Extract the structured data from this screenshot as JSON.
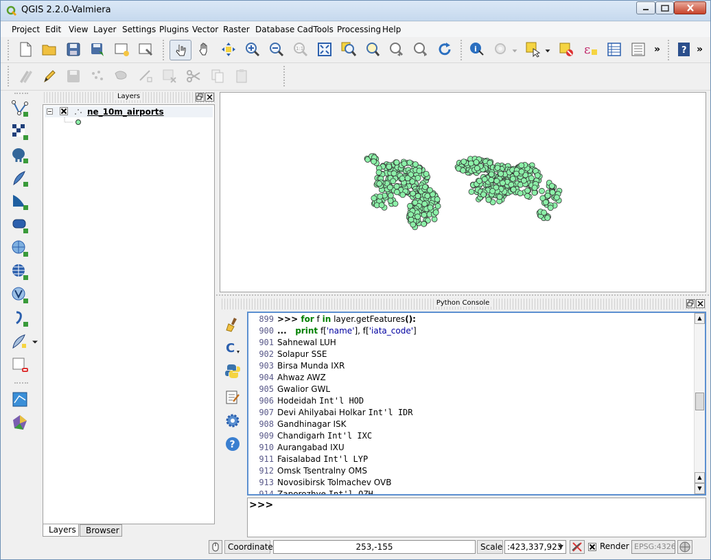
{
  "window": {
    "title": "QGIS 2.2.0-Valmiera",
    "app_icon": "qgis-logo-icon"
  },
  "menu": [
    "Project",
    "Edit",
    "View",
    "Layer",
    "Settings",
    "Plugins",
    "Vector",
    "Raster",
    "Database",
    "CadTools",
    "Processing",
    "Help"
  ],
  "toolbar_overflow": "»",
  "layers_panel": {
    "title": "Layers",
    "layer_name": "ne_10m_airports",
    "tabs": [
      "Layers",
      "Browser"
    ]
  },
  "console": {
    "title": "Python Console",
    "lines": [
      {
        "n": "899",
        "parts": [
          {
            "t": ">>> ",
            "c": "b"
          },
          {
            "t": "for",
            "c": "kw"
          },
          {
            "t": " f ",
            "c": ""
          },
          {
            "t": "in",
            "c": "kw"
          },
          {
            "t": " layer.getFeatures",
            "c": ""
          },
          {
            "t": "():",
            "c": "b"
          }
        ]
      },
      {
        "n": "900",
        "parts": [
          {
            "t": "...   ",
            "c": "b"
          },
          {
            "t": "print",
            "c": "kw"
          },
          {
            "t": " f[",
            "c": ""
          },
          {
            "t": "'name'",
            "c": "str"
          },
          {
            "t": "], f[",
            "c": ""
          },
          {
            "t": "'iata_code'",
            "c": "str"
          },
          {
            "t": "]",
            "c": ""
          }
        ]
      },
      {
        "n": "901",
        "parts": [
          {
            "t": "Sahnewal LUH",
            "c": ""
          }
        ]
      },
      {
        "n": "902",
        "parts": [
          {
            "t": "Solapur SSE",
            "c": ""
          }
        ]
      },
      {
        "n": "903",
        "parts": [
          {
            "t": "Birsa Munda IXR",
            "c": ""
          }
        ]
      },
      {
        "n": "904",
        "parts": [
          {
            "t": "Ahwaz AWZ",
            "c": ""
          }
        ]
      },
      {
        "n": "905",
        "parts": [
          {
            "t": "Gwalior GWL",
            "c": ""
          }
        ]
      },
      {
        "n": "906",
        "parts": [
          {
            "t": "Hodeidah ",
            "c": ""
          },
          {
            "t": "Int'l HOD",
            "c": "mono"
          }
        ]
      },
      {
        "n": "907",
        "parts": [
          {
            "t": "Devi Ahilyabai Holkar ",
            "c": ""
          },
          {
            "t": "Int'l IDR",
            "c": "mono"
          }
        ]
      },
      {
        "n": "908",
        "parts": [
          {
            "t": "Gandhinagar ISK",
            "c": ""
          }
        ]
      },
      {
        "n": "909",
        "parts": [
          {
            "t": "Chandigarh ",
            "c": ""
          },
          {
            "t": "Int'l IXC",
            "c": "mono"
          }
        ]
      },
      {
        "n": "910",
        "parts": [
          {
            "t": "Aurangabad IXU",
            "c": ""
          }
        ]
      },
      {
        "n": "911",
        "parts": [
          {
            "t": "Faisalabad ",
            "c": ""
          },
          {
            "t": "Int'l LYP",
            "c": "mono"
          }
        ]
      },
      {
        "n": "912",
        "parts": [
          {
            "t": "Omsk Tsentralny OMS",
            "c": ""
          }
        ]
      },
      {
        "n": "913",
        "parts": [
          {
            "t": "Novosibirsk Tolmachev OVB",
            "c": ""
          }
        ]
      },
      {
        "n": "914",
        "parts": [
          {
            "t": "Zaporozhye ",
            "c": ""
          },
          {
            "t": "Int'l OZH",
            "c": "mono"
          }
        ]
      }
    ],
    "prompt": ">>>"
  },
  "status": {
    "coordinate_label": "Coordinate:",
    "coordinate_value": "253,-155",
    "scale_label": "Scale",
    "scale_value": ":423,337,923",
    "render_label": "Render",
    "crs": "EPSG:4326"
  },
  "colors": {
    "point_fill": "#8cf0a8",
    "point_stroke": "#333333",
    "console_border": "#5b8fd0"
  }
}
